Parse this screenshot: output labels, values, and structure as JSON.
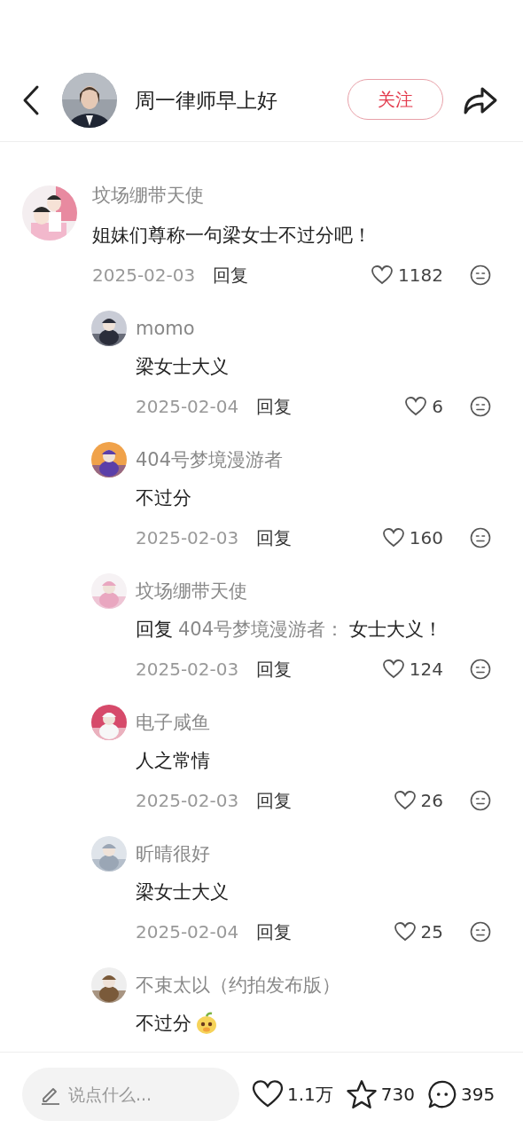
{
  "header": {
    "title": "周一律师早上好",
    "follow_button": "关注"
  },
  "comment": {
    "author": "坟场绷带天使",
    "text": "姐妹们尊称一句梁女士不过分吧！",
    "date": "2025-02-03",
    "reply_label": "回复",
    "likes": "1182"
  },
  "replies": [
    {
      "author": "momo",
      "text": "梁女士大义",
      "date": "2025-02-04",
      "reply_label": "回复",
      "likes": "6"
    },
    {
      "author": "404号梦境漫游者",
      "text": "不过分",
      "date": "2025-02-03",
      "reply_label": "回复",
      "likes": "160"
    },
    {
      "author": "坟场绷带天使",
      "reply_prefix": "回复",
      "reply_to": "404号梦境漫游者：",
      "text": "女士大义！",
      "date": "2025-02-03",
      "reply_label": "回复",
      "likes": "124"
    },
    {
      "author": "电子咸鱼",
      "text": "人之常情",
      "date": "2025-02-03",
      "reply_label": "回复",
      "likes": "26"
    },
    {
      "author": "昕晴很好",
      "text": "梁女士大义",
      "date": "2025-02-04",
      "reply_label": "回复",
      "likes": "25"
    },
    {
      "author": "不束太以（约拍发布版）",
      "text": "不过分",
      "sticker": true
    }
  ],
  "bottom_bar": {
    "placeholder": "说点什么...",
    "likes": "1.1万",
    "favorites": "730",
    "comments": "395"
  }
}
